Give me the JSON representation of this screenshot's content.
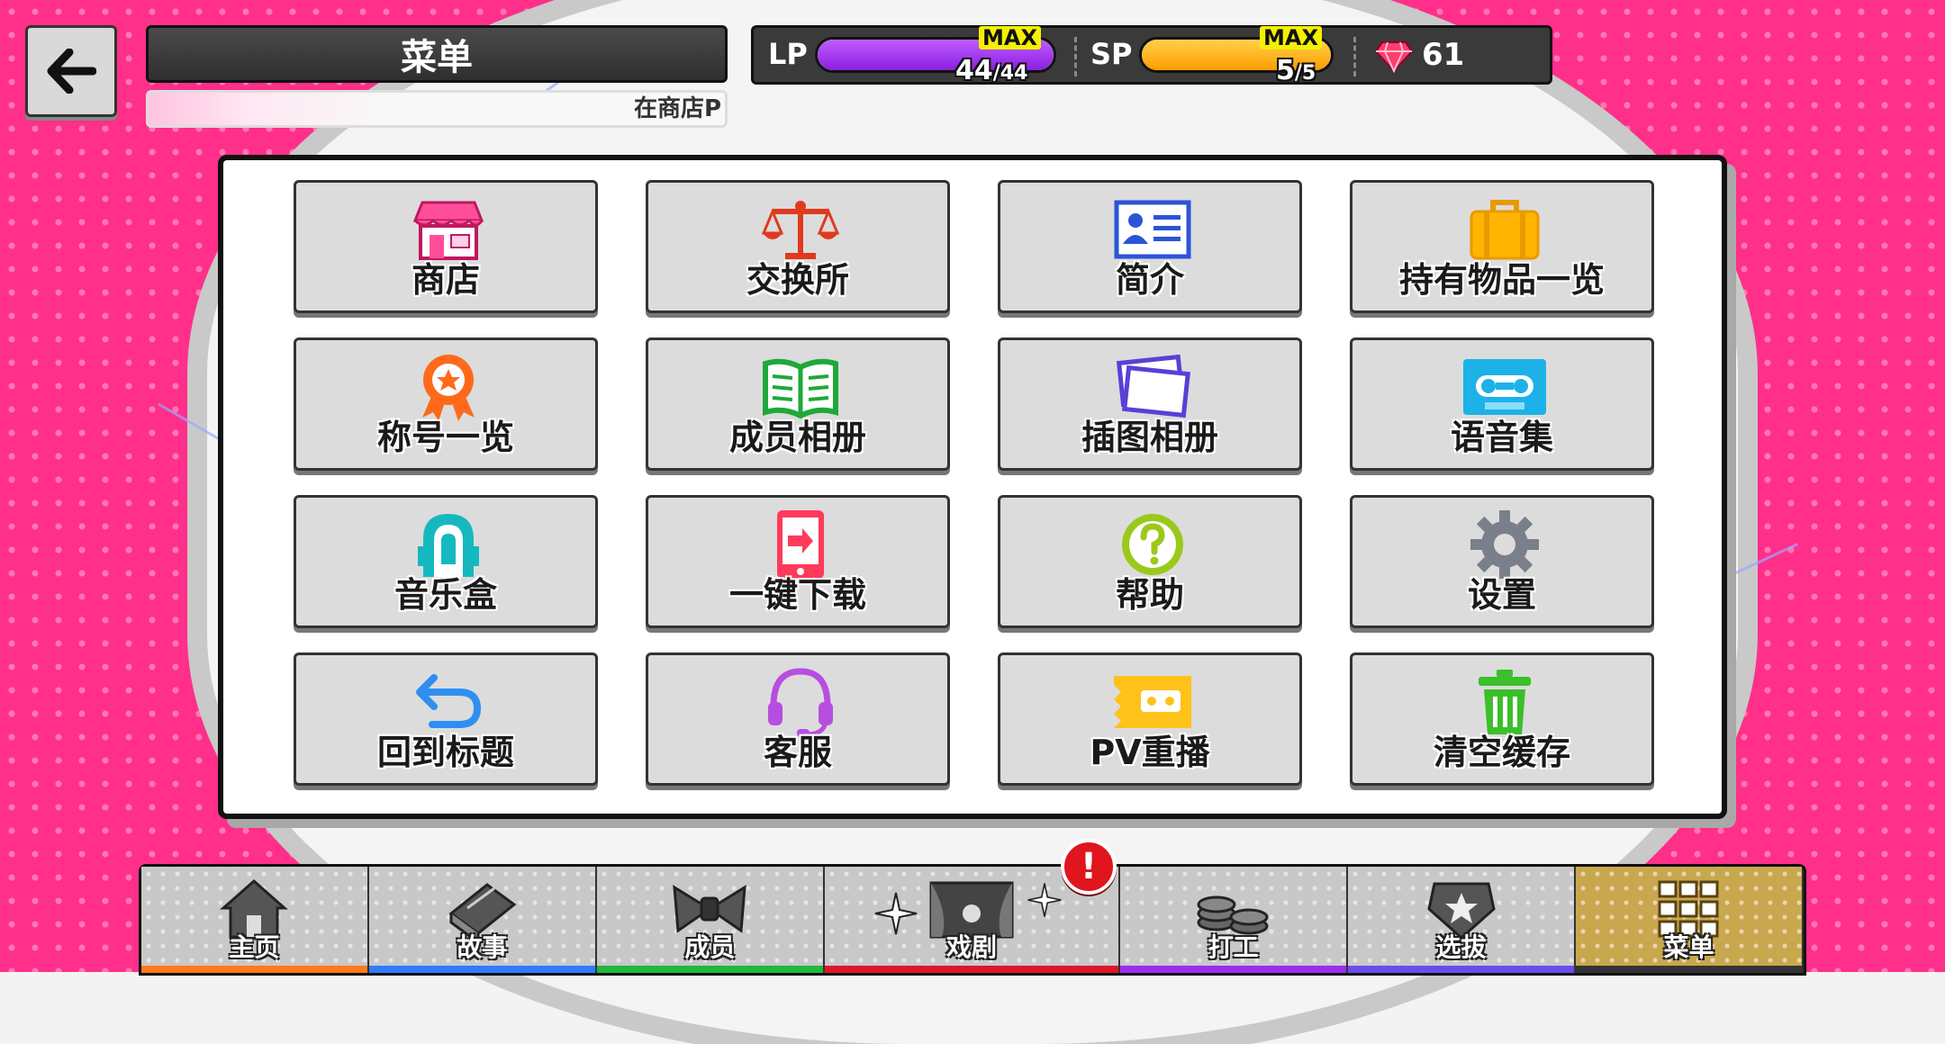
{
  "header": {
    "title": "菜单",
    "ticker": "在商店P"
  },
  "status": {
    "lp_label": "LP",
    "lp_max_tag": "MAX",
    "lp_value": "44",
    "lp_max": "/44",
    "lp_fill_fraction": 1.0,
    "sp_label": "SP",
    "sp_max_tag": "MAX",
    "sp_value": "5",
    "sp_max": "/5",
    "sp_fill_fraction": 1.0,
    "gems": "61"
  },
  "menu": {
    "items": [
      {
        "label": "商店",
        "icon": "shop-icon"
      },
      {
        "label": "交换所",
        "icon": "scales-icon"
      },
      {
        "label": "简介",
        "icon": "profile-card-icon"
      },
      {
        "label": "持有物品一览",
        "icon": "bag-icon"
      },
      {
        "label": "称号一览",
        "icon": "medal-icon"
      },
      {
        "label": "成员相册",
        "icon": "book-icon"
      },
      {
        "label": "插图相册",
        "icon": "photo-stack-icon"
      },
      {
        "label": "语音集",
        "icon": "cassette-icon"
      },
      {
        "label": "音乐盒",
        "icon": "jukebox-icon"
      },
      {
        "label": "一键下载",
        "icon": "phone-download-icon"
      },
      {
        "label": "帮助",
        "icon": "help-icon"
      },
      {
        "label": "设置",
        "icon": "gear-icon"
      },
      {
        "label": "回到标题",
        "icon": "return-arrow-icon"
      },
      {
        "label": "客服",
        "icon": "headset-icon"
      },
      {
        "label": "PV重播",
        "icon": "video-tape-icon"
      },
      {
        "label": "清空缓存",
        "icon": "trash-icon"
      }
    ]
  },
  "nav": {
    "tabs": [
      {
        "label": "主页",
        "icon": "house-icon"
      },
      {
        "label": "故事",
        "icon": "story-book-icon"
      },
      {
        "label": "成员",
        "icon": "bow-icon"
      },
      {
        "label": "戏剧",
        "icon": "stage-icon"
      },
      {
        "label": "打工",
        "icon": "coins-icon"
      },
      {
        "label": "选拔",
        "icon": "star-badge-icon"
      },
      {
        "label": "菜单",
        "icon": "grid-menu-icon"
      }
    ],
    "alert": "!"
  },
  "colors": {
    "lp_gauge": "#9b2cf0",
    "sp_gauge": "#ffb21a",
    "background_pink": "#ff2f8a",
    "active_tab": "#c9a74e"
  }
}
